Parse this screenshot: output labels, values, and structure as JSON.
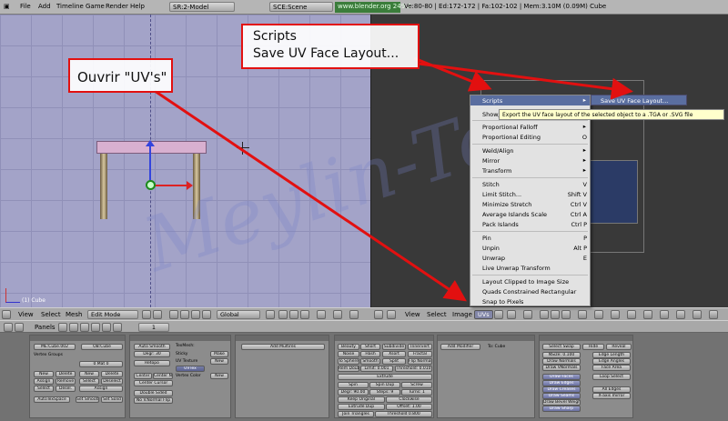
{
  "topbar": {
    "menus": [
      "File",
      "Add",
      "Timeline",
      "Game",
      "Render",
      "Help"
    ],
    "screen": "SR:2-Model",
    "scene": "SCE:Scene",
    "url": "www.blender.org 249.2",
    "stats": "Ve:80-80 | Ed:172-172 | Fa:102-102 | Mem:3.10M (0.09M) Cube"
  },
  "viewport3d": {
    "object_label": "(1) Cube",
    "header": {
      "view": "View",
      "select": "Select",
      "mesh": "Mesh",
      "mode": "Edit Mode",
      "orientation": "Global"
    }
  },
  "uv_editor": {
    "header": {
      "view": "View",
      "select": "Select",
      "image": "Image",
      "uvs": "UVs"
    }
  },
  "uv_menu": {
    "items": [
      {
        "label": "Scripts",
        "shortcut": "",
        "submenu": true,
        "highlight": true
      },
      {
        "label": "Show/Hide Faces",
        "shortcut": "",
        "submenu": true
      },
      {
        "label": "Proportional Falloff",
        "shortcut": "",
        "submenu": true
      },
      {
        "label": "Proportional Editing",
        "shortcut": "O"
      },
      {
        "label": "Weld/Align",
        "shortcut": "",
        "submenu": true
      },
      {
        "label": "Mirror",
        "shortcut": "",
        "submenu": true
      },
      {
        "label": "Transform",
        "shortcut": "",
        "submenu": true
      },
      {
        "label": "Stitch",
        "shortcut": "V"
      },
      {
        "label": "Limit Stitch...",
        "shortcut": "Shift V"
      },
      {
        "label": "Minimize Stretch",
        "shortcut": "Ctrl V"
      },
      {
        "label": "Average Islands Scale",
        "shortcut": "Ctrl A"
      },
      {
        "label": "Pack Islands",
        "shortcut": "Ctrl P"
      },
      {
        "label": "Pin",
        "shortcut": "P"
      },
      {
        "label": "Unpin",
        "shortcut": "Alt P"
      },
      {
        "label": "Unwrap",
        "shortcut": "E"
      },
      {
        "label": "Live Unwrap Transform",
        "shortcut": ""
      },
      {
        "label": "Layout Clipped to Image Size",
        "shortcut": ""
      },
      {
        "label": "Quads Constrained Rectangular",
        "shortcut": ""
      },
      {
        "label": "Snap to Pixels",
        "shortcut": ""
      }
    ],
    "submenu_item": "Save UV Face Layout...",
    "tooltip": "Export the UV face layout of the selected object to a .TGA or .SVG file"
  },
  "buttons_window": {
    "panels_label": "Panels",
    "frame": "1",
    "link": {
      "me": "ME:Cube.002",
      "ob": "OB:Cube",
      "vertex_groups": "Vertex Groups",
      "mat": "0 Mat 0",
      "new": "New",
      "delete": "Delete",
      "assign": "Assign",
      "remove": "Remove",
      "select": "Select",
      "deselect": "Deselect",
      "desel": "Desel.",
      "set_smooth": "Set Smooth",
      "set_solid": "Set Solid",
      "autotexspace": "AutoTexSpace"
    },
    "mesh": {
      "auto_smooth": "Auto Smooth",
      "degr": "Degr: 30",
      "texmesh": "TexMesh:",
      "sticky": "Sticky",
      "make": "Make",
      "uv_texture": "UV Texture",
      "vertex_color": "Vertex Color",
      "uvtex": "UVTex",
      "new": "New",
      "center": "Center",
      "center_new": "Center New",
      "center_cursor": "Center Cursor",
      "double_sided": "Double Sided",
      "no_v_normal_flip": "No V.Normal Flip",
      "retopo": "Retopo"
    },
    "multires": {
      "add": "Add Multires"
    },
    "mesh_tools": {
      "beauty": "Beauty",
      "short": "Short",
      "subdivide": "Subdivide",
      "innervert": "Innervert",
      "noise": "Noise",
      "hash": "Hash",
      "xsort": "Xsort",
      "fractal": "Fractal",
      "to_sphere": "To Sphere",
      "smooth": "Smooth",
      "split": "Split",
      "flip_normal": "Flip Normal",
      "rem_doubles": "Rem Doubles",
      "limit": "Limit: 0.001",
      "threshold": "Threshold: 0.010",
      "extrude": "Extrude",
      "spin": "Spin",
      "spin_dup": "Spin Dup",
      "screw": "Screw",
      "degr": "Degr: 90.00",
      "steps": "Steps: 9",
      "turns": "Turns: 1",
      "keep_original": "Keep Original",
      "clockwise": "Clockwise",
      "extrude_dup": "Extrude Dup",
      "offset": "Offset: 1.00",
      "join_triangles": "Join Triangles",
      "threshold2": "Threshold 0.800",
      "delimit": "Delimit UVs"
    },
    "modifiers": {
      "add": "Add Modifier",
      "to": "To: Cube"
    },
    "mesh_tools_more": {
      "select_swap": "Select Swap",
      "hide": "Hide",
      "reveal": "Reveal",
      "nsize": "NSize: 0.100",
      "draw_normals": "Draw Normals",
      "draw_vnormals": "Draw VNormals",
      "draw_faces": "Draw Faces",
      "draw_edges": "Draw Edges",
      "draw_creases": "Draw Creases",
      "draw_seams": "Draw Seams",
      "draw_bevel_weights": "Draw Bevel Weights",
      "draw_sharp": "Draw Sharp",
      "edge_length": "Edge Length",
      "edge_angles": "Edge Angles",
      "face_area": "Face Area",
      "loop_select": "Loop Select",
      "all_edges": "All Edges",
      "x_axis_mirror": "X-axis mirror"
    }
  },
  "annotations": {
    "uvs": "Ouvrir \"UV's\"",
    "scripts_line1": "Scripts",
    "scripts_line2": "Save UV Face Layout..."
  },
  "colors": {
    "accent_red": "#e21010",
    "menu_highlight": "#5a6ea0",
    "viewport_bg": "#a3a3c8"
  }
}
